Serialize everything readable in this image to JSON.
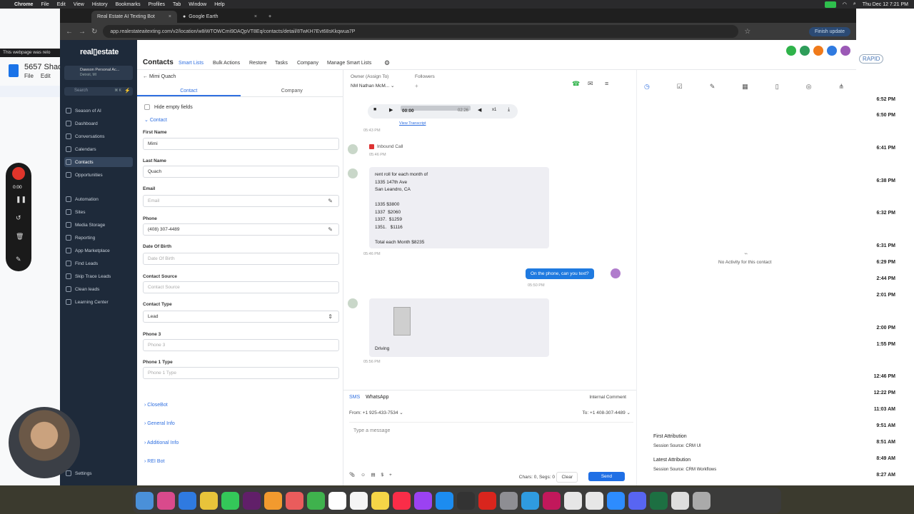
{
  "menubar": {
    "app": "Chrome",
    "items": [
      "File",
      "Edit",
      "View",
      "History",
      "Bookmarks",
      "Profiles",
      "Tab",
      "Window",
      "Help"
    ],
    "clock": "Thu Dec 12  7:21 PM"
  },
  "bgdoc": {
    "warning": "This webpage was relo",
    "title": "5657 Shad",
    "menus": [
      "File",
      "Edit"
    ]
  },
  "bgright": {
    "rapid": "RAPID",
    "times": [
      "6:52 PM",
      "6:50 PM",
      "6:41 PM",
      "6:38 PM",
      "6:32 PM",
      "6:31 PM",
      "6:29 PM",
      "2:44 PM",
      "2:01 PM",
      "2:00 PM",
      "1:55 PM",
      "12:46 PM",
      "12:22 PM",
      "11:03 AM",
      "9:51 AM",
      "8:51 AM",
      "8:49 AM",
      "8:27 AM"
    ]
  },
  "chrome": {
    "tabs": [
      "Real Estate AI Texting Bot",
      "Google Earth"
    ],
    "url": "app.realestateaitexting.com/v2/location/w8iWTOWCmi9DAQpVT8Eq/contacts/detail/8TwKH7Evt68sKkqwua7P",
    "finish_update": "Finish update"
  },
  "sidebar": {
    "logo": "real▯estate",
    "account_name": "Dawson Personal Ac...",
    "account_sub": "Detroit, MI",
    "search_placeholder": "Search",
    "search_shortcut": "⌘ K",
    "items": [
      {
        "label": "Season of AI"
      },
      {
        "label": "Dashboard"
      },
      {
        "label": "Conversations"
      },
      {
        "label": "Calendars"
      },
      {
        "label": "Contacts"
      },
      {
        "label": "Opportunities"
      },
      {
        "label": "Automation"
      },
      {
        "label": "Sites"
      },
      {
        "label": "Media Storage"
      },
      {
        "label": "Reporting"
      },
      {
        "label": "App Marketplace"
      },
      {
        "label": "Find Leads"
      },
      {
        "label": "Skip Trace Leads"
      },
      {
        "label": "Clean leads"
      },
      {
        "label": "Learning Center"
      }
    ],
    "settings": "Settings"
  },
  "topnav": {
    "title": "Contacts",
    "items": [
      "Smart Lists",
      "Bulk Actions",
      "Restore",
      "Tasks",
      "Company",
      "Manage Smart Lists"
    ]
  },
  "contact": {
    "back_name": "Mimi Quach",
    "tabs": [
      "Contact",
      "Company"
    ],
    "hide_empty": "Hide empty fields",
    "section": "Contact",
    "first_name_label": "First Name",
    "first_name": "Mimi",
    "last_name_label": "Last Name",
    "last_name": "Quach",
    "email_label": "Email",
    "email_placeholder": "Email",
    "phone_label": "Phone",
    "phone": "(408) 307-4489",
    "dob_label": "Date Of Birth",
    "dob_placeholder": "Date Of Birth",
    "source_label": "Contact Source",
    "source_placeholder": "Contact Source",
    "type_label": "Contact Type",
    "type_value": "Lead",
    "phone3_label": "Phone 3",
    "phone3_placeholder": "Phone 3",
    "phone1type_label": "Phone 1 Type",
    "phone1type_placeholder": "Phone 1 Type",
    "accordions": [
      "CloseBot",
      "General Info",
      "Additional Info",
      "REI Bot"
    ]
  },
  "conversation": {
    "owner_label": "Owner (Assign To)",
    "followers_label": "Followers",
    "owner_initials": "NM",
    "owner_name": "Nathan McM...",
    "audio_time": "00:00",
    "audio_duration": "02:26",
    "audio_speed": "x1",
    "transcript_link": "View Transcript",
    "audio_time_meta": "05:43 PM",
    "call_label": "Inbound Call",
    "call_time": "05:46 PM",
    "msg1": "rent roll for each month of\n1335 147th Ave\nSan Leandro, CA\n\n1335 $3800\n1337  $2060\n1337.  $1259\n1351.   $1116\n\nTotal each Month $8235",
    "msg1_time": "05:46 PM",
    "out_msg": "On the phone, can you text?",
    "out_time": "05:50 PM",
    "img_caption": "Driving",
    "img_time": "05:56 PM"
  },
  "composer": {
    "tabs": [
      "SMS",
      "WhatsApp"
    ],
    "internal": "Internal Comment",
    "from_label": "From:",
    "from": "+1 925-433-7534",
    "to_label": "To:",
    "to": "+1 408-307-4489",
    "placeholder": "Type a message",
    "chars": "Chars: 0, Segs: 0",
    "clear": "Clear",
    "send": "Send"
  },
  "activity": {
    "none": "No Activity for this contact",
    "first_attr": "First Attribution",
    "first_source": "Session Source: CRM UI",
    "latest_attr": "Latest Attribution",
    "latest_source": "Session Source: CRM Workflows"
  },
  "recorder": {
    "time": "0:00"
  }
}
